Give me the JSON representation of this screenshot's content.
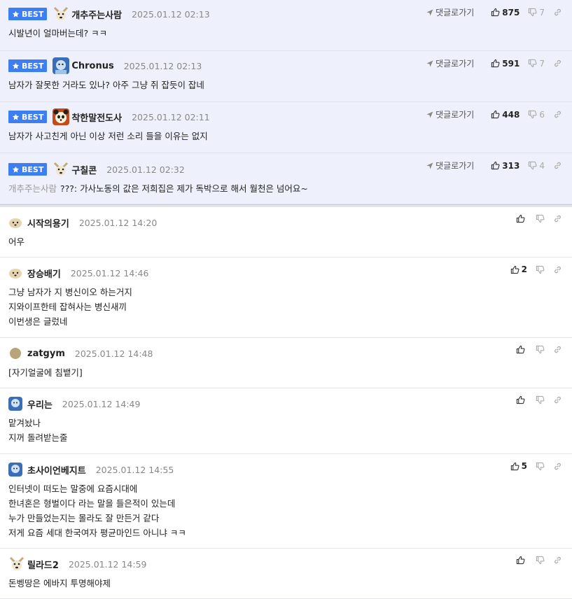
{
  "colors": {
    "accent": "#3d7ff0",
    "best_bg": "#eef1fb",
    "muted": "#888888"
  },
  "best_badge_label": "BEST",
  "reply_label": "댓글로가기",
  "best_comments": [
    {
      "nick": "개추주는사람",
      "date": "2025.01.12 02:13",
      "text": "시발년이 얼마버는데? ㅋㅋ",
      "up": "875",
      "down": "7",
      "avatar": "dog-icon"
    },
    {
      "nick": "Chronus",
      "date": "2025.01.12 02:13",
      "text": "남자가 잘못한 거라도 있나? 아주 그냥 쥐 잡듯이 잡네",
      "up": "591",
      "down": "7",
      "avatar": "blue-avatar-icon"
    },
    {
      "nick": "착한말전도사",
      "date": "2025.01.12 02:11",
      "text": "남자가 사고친게 아닌 이상 저런 소리 들을 이유는 없지",
      "up": "448",
      "down": "6",
      "avatar": "panda-icon"
    },
    {
      "nick": "구칠콘",
      "date": "2025.01.12 02:32",
      "mention": "개추주는사람",
      "text": "???: 가사노동의 값은 저희집은 제가 독박으로 해서 월천은 넘어요~",
      "up": "313",
      "down": "4",
      "avatar": "dog-icon"
    }
  ],
  "comments": [
    {
      "nick": "시작의용기",
      "date": "2025.01.12 14:20",
      "lines": [
        "어우"
      ],
      "up": "",
      "avatar": "puppy-icon"
    },
    {
      "nick": "장승배기",
      "date": "2025.01.12 14:46",
      "lines": [
        "그냥 남자가 지 병신이오 하는거지",
        "지와이프한테 잡혀사는 병신새끼",
        "이번생은 글렀네"
      ],
      "up": "2",
      "avatar": "puppy-icon"
    },
    {
      "nick": "zatgym",
      "date": "2025.01.12 14:48",
      "lines": [
        "[자기얼굴에 침뱉기]"
      ],
      "up": "",
      "avatar": "dot-icon"
    },
    {
      "nick": "우리는",
      "date": "2025.01.12 14:49",
      "lines": [
        "맡겨놨나",
        "지꺼 돌려받는줄"
      ],
      "up": "",
      "avatar": "blue-avatar-icon"
    },
    {
      "nick": "초사이언베지트",
      "date": "2025.01.12 14:55",
      "lines": [
        "인터넷이 떠도는 말중에 요즘시대에",
        "한녀혼은 형벌이다 라는 말을 들은적이 있는데",
        "누가 만들었는지는 몰라도 잘 만든거 같다",
        "저게 요즘 세대 한국여자 평균마인드 아니냐 ㅋㅋ"
      ],
      "up": "5",
      "avatar": "blue-avatar-icon"
    },
    {
      "nick": "릴라드2",
      "date": "2025.01.12 14:59",
      "lines": [
        "돈벵땅은 에바지 투명해야제"
      ],
      "up": "",
      "avatar": "dog-icon"
    }
  ]
}
